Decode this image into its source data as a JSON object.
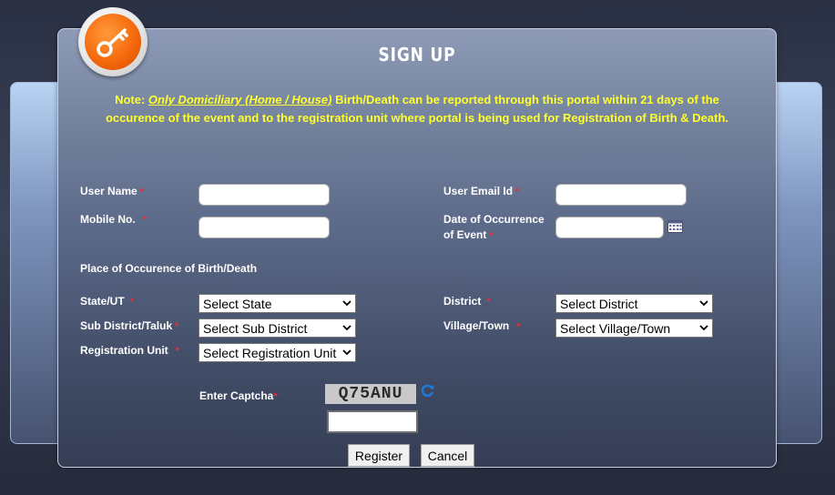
{
  "header": {
    "title": "SIGN UP",
    "logo_icon": "key-icon"
  },
  "note": {
    "prefix": "Note: ",
    "emphasis": "Only Domiciliary (Home / House)",
    "text": " Birth/Death can be reported through this portal within 21 days of the occurence of the event and to the registration unit where portal is being used for Registration of Birth & Death."
  },
  "form": {
    "user_name_label": "User Name",
    "user_name_value": "",
    "user_email_label": "User Email Id",
    "user_email_value": "",
    "mobile_label": "Mobile No.",
    "mobile_value": "",
    "date_label_line1": "Date of Occurrence",
    "date_label_line2": "of Event",
    "date_value": "",
    "required_mark": "*",
    "place_heading": "Place of Occurence of Birth/Death",
    "state_label": "State/UT",
    "state_selected": "Select State",
    "district_label": "District",
    "district_selected": "Select District",
    "subdistrict_label": "Sub District/Taluk",
    "subdistrict_selected": "Select Sub District",
    "village_label": "Village/Town",
    "village_selected": "Select Village/Town",
    "regunit_label": "Registration Unit",
    "regunit_selected": "Select Registration Unit",
    "captcha_label": "Enter Captcha",
    "captcha_text": "Q75ANU",
    "captcha_value": ""
  },
  "buttons": {
    "register": "Register",
    "cancel": "Cancel"
  },
  "colors": {
    "note_text": "#ffff2b",
    "required": "#e83030",
    "logo_orange": "#f56a0c"
  }
}
